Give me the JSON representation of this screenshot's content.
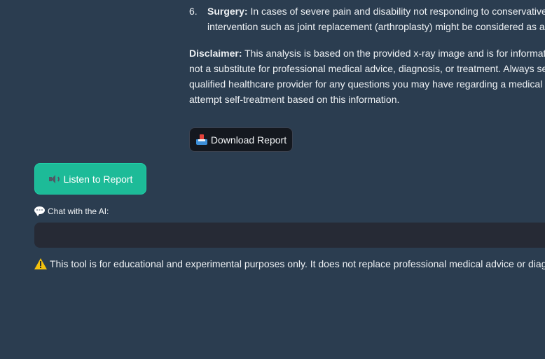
{
  "report": {
    "list_item": {
      "number": "6.",
      "title": "Surgery:",
      "line1": " In cases of severe pain and disability not responding to conservative mea",
      "line2": "intervention such as joint replacement (arthroplasty) might be considered as a las"
    },
    "disclaimer": {
      "label": "Disclaimer:",
      "line1": " This analysis is based on the provided x-ray image and is for informational",
      "line2": "not a substitute for professional medical advice, diagnosis, or treatment. Always seek",
      "line3": "qualified healthcare provider for any questions you may have regarding a medical con",
      "line4": "attempt self-treatment based on this information."
    }
  },
  "buttons": {
    "download_label": "Download Report",
    "download_icon": "inbox-tray-icon",
    "listen_label": "Listen to Report",
    "listen_icon": "speaker-icon"
  },
  "chat": {
    "label": "Chat with the AI:",
    "icon": "speech-bubble-icon",
    "input_value": ""
  },
  "footer": {
    "warning": "This tool is for educational and experimental purposes only. It does not replace professional medical advice or diagnosis",
    "icon": "warning-icon"
  },
  "colors": {
    "background": "#2b3d50",
    "accent": "#1dbb98",
    "dark_button": "#14181f",
    "input_bg": "#262a35"
  }
}
